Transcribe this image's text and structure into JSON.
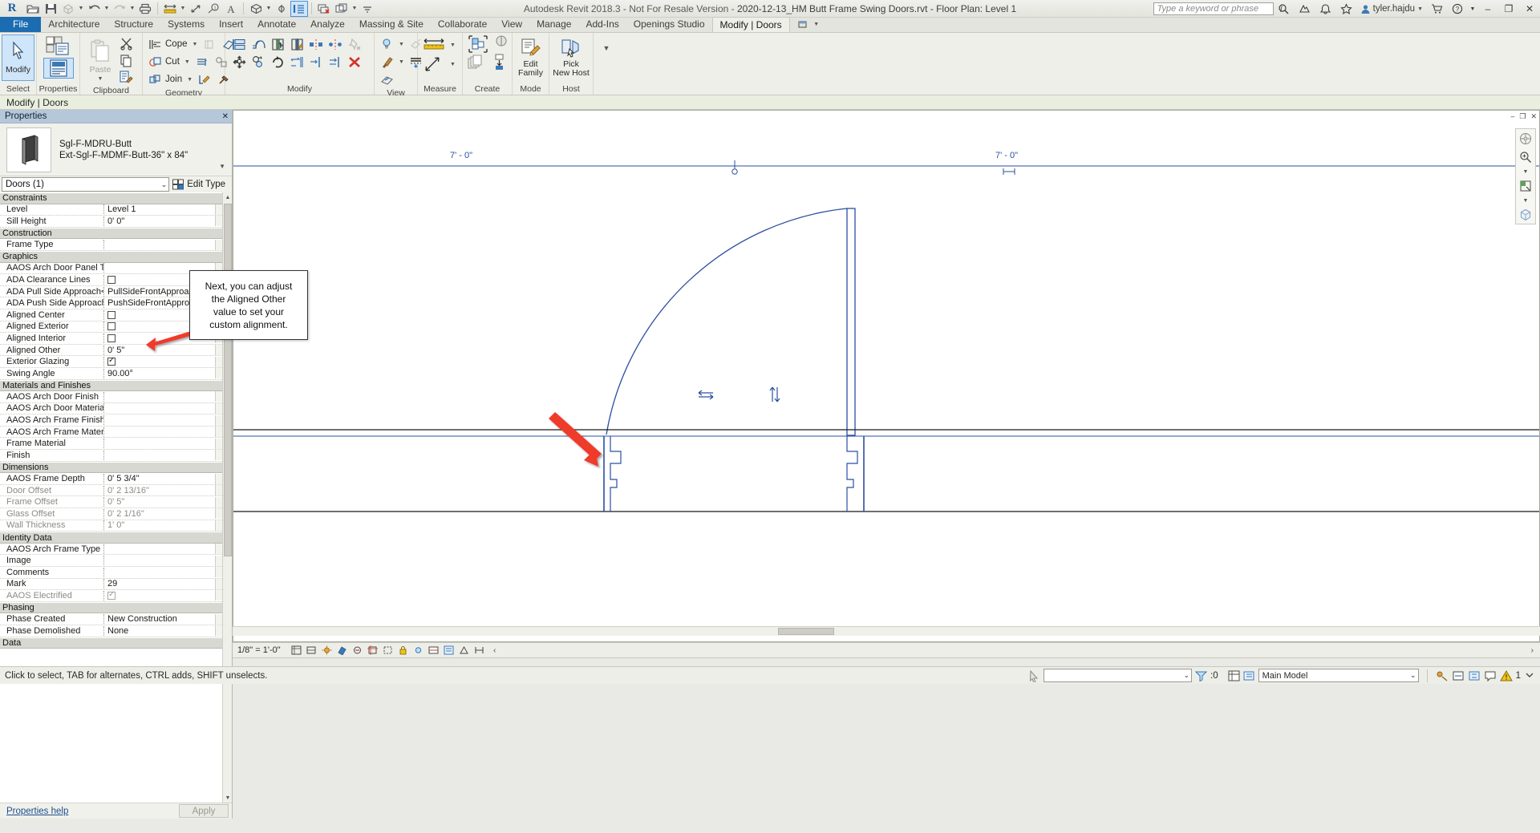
{
  "window": {
    "title_app": "Autodesk Revit 2018.3 - Not For Resale Version -",
    "title_file": "2020-12-13_HM Butt Frame Swing Doors.rvt - Floor Plan: Level 1",
    "user": "tyler.hajdu",
    "minimize": "–",
    "restore": "❐",
    "close": "✕",
    "help": "?",
    "help_caret": "▾"
  },
  "search": {
    "placeholder": "Type a keyword or phrase",
    "value": ""
  },
  "qat": {
    "icons": [
      {
        "name": "revit-logo-icon",
        "glyph": "R"
      },
      {
        "name": "open-icon",
        "glyph": "open"
      },
      {
        "name": "save-icon",
        "glyph": "save"
      },
      {
        "name": "sync-with-central-icon",
        "glyph": "sync"
      },
      {
        "name": "undo-icon",
        "glyph": "undo"
      },
      {
        "name": "redo-icon",
        "glyph": "redo"
      },
      {
        "name": "print-icon",
        "glyph": "print"
      },
      {
        "name": "measure-icon",
        "glyph": "measure"
      },
      {
        "name": "aligned-dimension-icon",
        "glyph": "aligned-dim"
      },
      {
        "name": "tag-icon",
        "glyph": "tag"
      },
      {
        "name": "text-icon",
        "glyph": "A"
      },
      {
        "name": "default-3d-view-icon",
        "glyph": "3d"
      },
      {
        "name": "section-icon",
        "glyph": "section"
      },
      {
        "name": "thin-lines-icon",
        "glyph": "thin-lines"
      },
      {
        "name": "close-hidden-windows-icon",
        "glyph": "close-hidden"
      },
      {
        "name": "switch-windows-icon",
        "glyph": "switch-win"
      },
      {
        "name": "customize-qat-icon",
        "glyph": "customize"
      }
    ]
  },
  "tabs": [
    {
      "label": "File",
      "kind": "file"
    },
    {
      "label": "Architecture",
      "kind": "normal"
    },
    {
      "label": "Structure",
      "kind": "normal"
    },
    {
      "label": "Systems",
      "kind": "normal"
    },
    {
      "label": "Insert",
      "kind": "normal"
    },
    {
      "label": "Annotate",
      "kind": "normal"
    },
    {
      "label": "Analyze",
      "kind": "normal"
    },
    {
      "label": "Massing & Site",
      "kind": "normal"
    },
    {
      "label": "Collaborate",
      "kind": "normal"
    },
    {
      "label": "View",
      "kind": "normal"
    },
    {
      "label": "Manage",
      "kind": "normal"
    },
    {
      "label": "Add-Ins",
      "kind": "normal"
    },
    {
      "label": "Openings Studio",
      "kind": "normal"
    },
    {
      "label": "Modify | Doors",
      "kind": "active"
    }
  ],
  "ribbon": {
    "panels": [
      {
        "label": "Select",
        "name": "panel-select",
        "big": [
          {
            "label": "Modify",
            "name": "modify-button",
            "selected": true
          }
        ]
      },
      {
        "label": "Properties",
        "name": "panel-properties",
        "big": [
          {
            "label": "",
            "name": "type-properties-button",
            "selected": false
          },
          {
            "label": "",
            "name": "properties-button",
            "selected": true
          }
        ]
      },
      {
        "label": "Clipboard",
        "name": "panel-clipboard",
        "big": [
          {
            "label": "Paste",
            "name": "paste-button",
            "selected": false
          }
        ],
        "small": [
          "cut-icon",
          "copy-icon",
          "match-type-properties-icon"
        ]
      },
      {
        "label": "Geometry",
        "name": "panel-geometry",
        "items": [
          {
            "label": "Cope",
            "name": "cope-button",
            "dropdown": true
          },
          {
            "label": "Cut",
            "name": "cut-geometry-button",
            "dropdown": true
          },
          {
            "label": "Join",
            "name": "join-geometry-button",
            "dropdown": true
          }
        ],
        "small": [
          "paint-icon",
          "demolish-icon",
          "split-face-icon",
          "wall-joins-icon",
          "beam-join-icon",
          "switch-join-order-icon"
        ]
      },
      {
        "label": "Modify",
        "name": "panel-modify",
        "small": [
          "align-icon",
          "offset-icon",
          "mirror-pick-axis-icon",
          "mirror-draw-axis-icon",
          "move-icon",
          "copy-icon",
          "rotate-icon",
          "trim-extend-icon",
          "split-element-icon",
          "array-icon",
          "scale-icon",
          "pin-icon",
          "unpin-icon",
          "delete-icon"
        ]
      },
      {
        "label": "View",
        "name": "panel-view",
        "small": [
          "visibility-graphics-icon",
          "hide-element-icon",
          "linework-icon",
          "override-icon",
          "render-icon"
        ]
      },
      {
        "label": "Measure",
        "name": "panel-measure",
        "small": [
          "measure-between-references-icon",
          "measure-along-element-icon"
        ]
      },
      {
        "label": "Create",
        "name": "panel-create",
        "small": [
          "create-group-icon",
          "create-similar-icon",
          "create-part-icon",
          "create-assembly-icon"
        ]
      },
      {
        "label": "Mode",
        "name": "panel-mode",
        "big": [
          {
            "label": "Edit\nFamily",
            "name": "edit-family-button",
            "selected": false
          }
        ]
      },
      {
        "label": "Host",
        "name": "panel-host",
        "big": [
          {
            "label": "Pick\nNew Host",
            "name": "pick-new-host-button",
            "selected": false
          }
        ]
      }
    ],
    "panel_labels": [
      "Select",
      "Properties",
      "Clipboard",
      "Geometry",
      "Modify",
      "View",
      "Measure",
      "Create",
      "Mode",
      "Host"
    ],
    "edit_family_label_1": "Edit",
    "edit_family_label_2": "Family",
    "pick_host_label_1": "Pick",
    "pick_host_label_2": "New Host",
    "modify_label": "Modify",
    "paste_label": "Paste",
    "cope_label": "Cope",
    "cut_label": "Cut",
    "join_label": "Join"
  },
  "context_bar": {
    "text": "Modify | Doors"
  },
  "properties": {
    "title": "Properties",
    "close_glyph": "✕",
    "type_name_line1": "Sgl-F-MDRU-Butt",
    "type_name_line2": "Ext-Sgl-F-MDMF-Butt-36\" x 84\"",
    "selector_value": "Doors (1)",
    "selector_caret": "∨",
    "edit_type_label": "Edit Type",
    "help_link": "Properties help",
    "apply_label": "Apply",
    "rows": [
      {
        "type": "group",
        "name": "Constraints"
      },
      {
        "type": "row",
        "name": "Level",
        "value": "Level 1",
        "dim": false,
        "control": "text"
      },
      {
        "type": "row",
        "name": "Sill Height",
        "value": "0'  0\"",
        "dim": false,
        "control": "text"
      },
      {
        "type": "group",
        "name": "Construction"
      },
      {
        "type": "row",
        "name": "Frame Type",
        "value": "",
        "dim": false,
        "control": "text"
      },
      {
        "type": "group",
        "name": "Graphics"
      },
      {
        "type": "row",
        "name": "AAOS Arch Door Panel Type",
        "value": "",
        "dim": false,
        "control": "text"
      },
      {
        "type": "row",
        "name": "ADA Clearance Lines",
        "value": "",
        "dim": false,
        "control": "checkbox",
        "checked": false
      },
      {
        "type": "row",
        "name": "ADA Pull Side Approach<...",
        "value": "PullSideFrontApproach",
        "dim": false,
        "control": "text"
      },
      {
        "type": "row",
        "name": "ADA Push Side Approach...",
        "value": "PushSideFrontApproach",
        "dim": false,
        "control": "text"
      },
      {
        "type": "row",
        "name": "Aligned Center",
        "value": "",
        "dim": false,
        "control": "checkbox",
        "checked": false
      },
      {
        "type": "row",
        "name": "Aligned Exterior",
        "value": "",
        "dim": false,
        "control": "checkbox",
        "checked": false
      },
      {
        "type": "row",
        "name": "Aligned Interior",
        "value": "",
        "dim": false,
        "control": "checkbox",
        "checked": false
      },
      {
        "type": "row",
        "name": "Aligned Other",
        "value": "0'  5\"",
        "dim": false,
        "control": "text",
        "highlight": true
      },
      {
        "type": "row",
        "name": "Exterior Glazing",
        "value": "",
        "dim": false,
        "control": "checkbox",
        "checked": true
      },
      {
        "type": "row",
        "name": "Swing Angle",
        "value": "90.00°",
        "dim": false,
        "control": "text"
      },
      {
        "type": "group",
        "name": "Materials and Finishes"
      },
      {
        "type": "row",
        "name": "AAOS Arch Door Finish",
        "value": "",
        "dim": false,
        "control": "text"
      },
      {
        "type": "row",
        "name": "AAOS Arch Door Material ...",
        "value": "",
        "dim": false,
        "control": "text"
      },
      {
        "type": "row",
        "name": "AAOS Arch Frame Finish",
        "value": "",
        "dim": false,
        "control": "text"
      },
      {
        "type": "row",
        "name": "AAOS Arch Frame Materia...",
        "value": "",
        "dim": false,
        "control": "text"
      },
      {
        "type": "row",
        "name": "Frame Material",
        "value": "",
        "dim": false,
        "control": "text"
      },
      {
        "type": "row",
        "name": "Finish",
        "value": "",
        "dim": false,
        "control": "text"
      },
      {
        "type": "group",
        "name": "Dimensions"
      },
      {
        "type": "row",
        "name": "AAOS Frame Depth",
        "value": "0'  5 3/4\"",
        "dim": false,
        "control": "text"
      },
      {
        "type": "row",
        "name": "Door Offset",
        "value": "0'  2 13/16\"",
        "dim": true,
        "control": "text"
      },
      {
        "type": "row",
        "name": "Frame Offset",
        "value": "0'  5\"",
        "dim": true,
        "control": "text"
      },
      {
        "type": "row",
        "name": "Glass Offset",
        "value": "0'  2 1/16\"",
        "dim": true,
        "control": "text"
      },
      {
        "type": "row",
        "name": "Wall Thickness",
        "value": "1'  0\"",
        "dim": true,
        "control": "text"
      },
      {
        "type": "group",
        "name": "Identity Data"
      },
      {
        "type": "row",
        "name": "AAOS Arch Frame Type",
        "value": "",
        "dim": false,
        "control": "text"
      },
      {
        "type": "row",
        "name": "Image",
        "value": "",
        "dim": false,
        "control": "text"
      },
      {
        "type": "row",
        "name": "Comments",
        "value": "",
        "dim": false,
        "control": "text"
      },
      {
        "type": "row",
        "name": "Mark",
        "value": "29",
        "dim": false,
        "control": "text"
      },
      {
        "type": "row",
        "name": "AAOS Electrified",
        "value": "",
        "dim": true,
        "control": "checkbox",
        "checked": true,
        "graycheck": true
      },
      {
        "type": "group",
        "name": "Phasing"
      },
      {
        "type": "row",
        "name": "Phase Created",
        "value": "New Construction",
        "dim": false,
        "control": "text"
      },
      {
        "type": "row",
        "name": "Phase Demolished",
        "value": "None",
        "dim": false,
        "control": "text"
      },
      {
        "type": "group",
        "name": "Data"
      }
    ]
  },
  "callout": {
    "line1": "Next, you can adjust",
    "line2": "the Aligned Other",
    "line3": "value to set your",
    "line4": "custom alignment.",
    "text": "Next, you can adjust the Aligned Other value to set your custom alignment.",
    "arrow_color": "#ef3a2c"
  },
  "canvas": {
    "dim_left": "7' - 0\"",
    "dim_right": "7' - 0\"",
    "line_color": "#2b4fa0",
    "minimize_glyph": "–",
    "restore_glyph": "❐",
    "close_glyph": "✕"
  },
  "view_control_bar": {
    "scale": "1/8\" = 1'-0\"",
    "icons": [
      "detail-level-icon",
      "visual-style-icon",
      "sun-path-icon",
      "shadows-icon",
      "render-dialog-icon",
      "crop-view-icon",
      "show-crop-region-icon",
      "temporary-hide-isolate-icon",
      "reveal-hidden-elements-icon",
      "temporary-view-properties-icon",
      "analytical-model-icon",
      "constraints-icon",
      "more-icon"
    ]
  },
  "status_bar": {
    "message": "Click to select, TAB for alternates, CTRL adds, SHIFT unselects.",
    "filter_value": "",
    "filter_caret": "∨",
    "selection_count": ":0",
    "model_value": "Main Model",
    "model_caret": "∨",
    "right_icons": [
      "worksets-icon",
      "design-options-icon",
      "exclude-options-icon",
      "active-workset-icon",
      "editing-request-icon",
      "filter-icon"
    ],
    "warning_count": "1"
  }
}
